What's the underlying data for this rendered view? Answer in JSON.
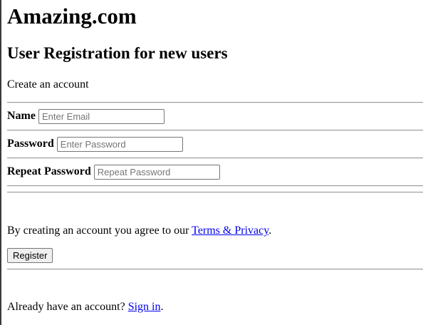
{
  "header": {
    "site_title": "Amazing.com",
    "page_heading": "User Registration for new users",
    "subtitle": "Create an account"
  },
  "form": {
    "fields": [
      {
        "label": "Name",
        "placeholder": "Enter Email",
        "value": ""
      },
      {
        "label": "Password",
        "placeholder": "Enter Password",
        "value": ""
      },
      {
        "label": "Repeat Password",
        "placeholder": "Repeat Password",
        "value": ""
      }
    ],
    "agreement_prefix": "By creating an account you agree to our ",
    "terms_link": "Terms & Privacy",
    "agreement_suffix": ".",
    "register_label": "Register"
  },
  "footer": {
    "signin_prefix": "Already have an account? ",
    "signin_link": "Sign in",
    "signin_suffix": "."
  },
  "colors": {
    "link": "#0000ee",
    "rule": "#9a9a9a",
    "button_bg": "#efefef"
  }
}
